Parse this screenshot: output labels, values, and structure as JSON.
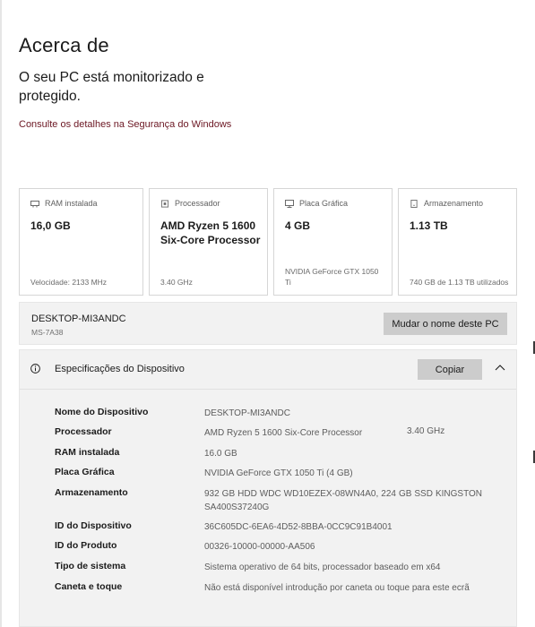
{
  "header": {
    "title": "Acerca de",
    "security_status": "O seu PC está monitorizado e protegido.",
    "security_link": "Consulte os detalhes na Segurança do Windows"
  },
  "cards": [
    {
      "icon": "ram-icon",
      "label": "RAM instalada",
      "value": "16,0 GB",
      "footer": "Velocidade: 2133 MHz"
    },
    {
      "icon": "processor-icon",
      "label": "Processador",
      "value": "AMD Ryzen 5 1600 Six-Core Processor",
      "footer": "3.40 GHz"
    },
    {
      "icon": "graphics-card-icon",
      "label": "Placa Gráfica",
      "value": "4 GB",
      "footer": "NVIDIA GeForce GTX 1050 Ti"
    },
    {
      "icon": "storage-icon",
      "label": "Armazenamento",
      "value": "1.13 TB",
      "footer": "740 GB de 1.13 TB utilizados"
    }
  ],
  "device": {
    "name": "DESKTOP-MI3ANDC",
    "model": "MS-7A38",
    "rename_button": "Mudar o nome deste PC"
  },
  "specs": {
    "title": "Especificações do Dispositivo",
    "copy_button": "Copiar",
    "rows": [
      {
        "label": "Nome do Dispositivo",
        "value": "DESKTOP-MI3ANDC"
      },
      {
        "label": "Processador",
        "value": "AMD Ryzen 5 1600 Six-Core Processor",
        "extra": "3.40 GHz"
      },
      {
        "label": "RAM instalada",
        "value": "16.0 GB"
      },
      {
        "label": "Placa Gráfica",
        "value": "NVIDIA GeForce GTX 1050 Ti (4 GB)"
      },
      {
        "label": "Armazenamento",
        "value": "932 GB HDD WDC WD10EZEX-08WN4A0, 224 GB SSD KINGSTON SA400S37240G"
      },
      {
        "label": "ID do Dispositivo",
        "value": "36C605DC-6EA6-4D52-8BBA-0CC9C91B4001"
      },
      {
        "label": "ID do Produto",
        "value": "00326-10000-00000-AA506"
      },
      {
        "label": "Tipo de sistema",
        "value": "Sistema operativo de 64 bits, processador baseado em x64"
      },
      {
        "label": "Caneta e toque",
        "value": "Não está disponível introdução por caneta ou toque para este ecrã"
      }
    ]
  }
}
